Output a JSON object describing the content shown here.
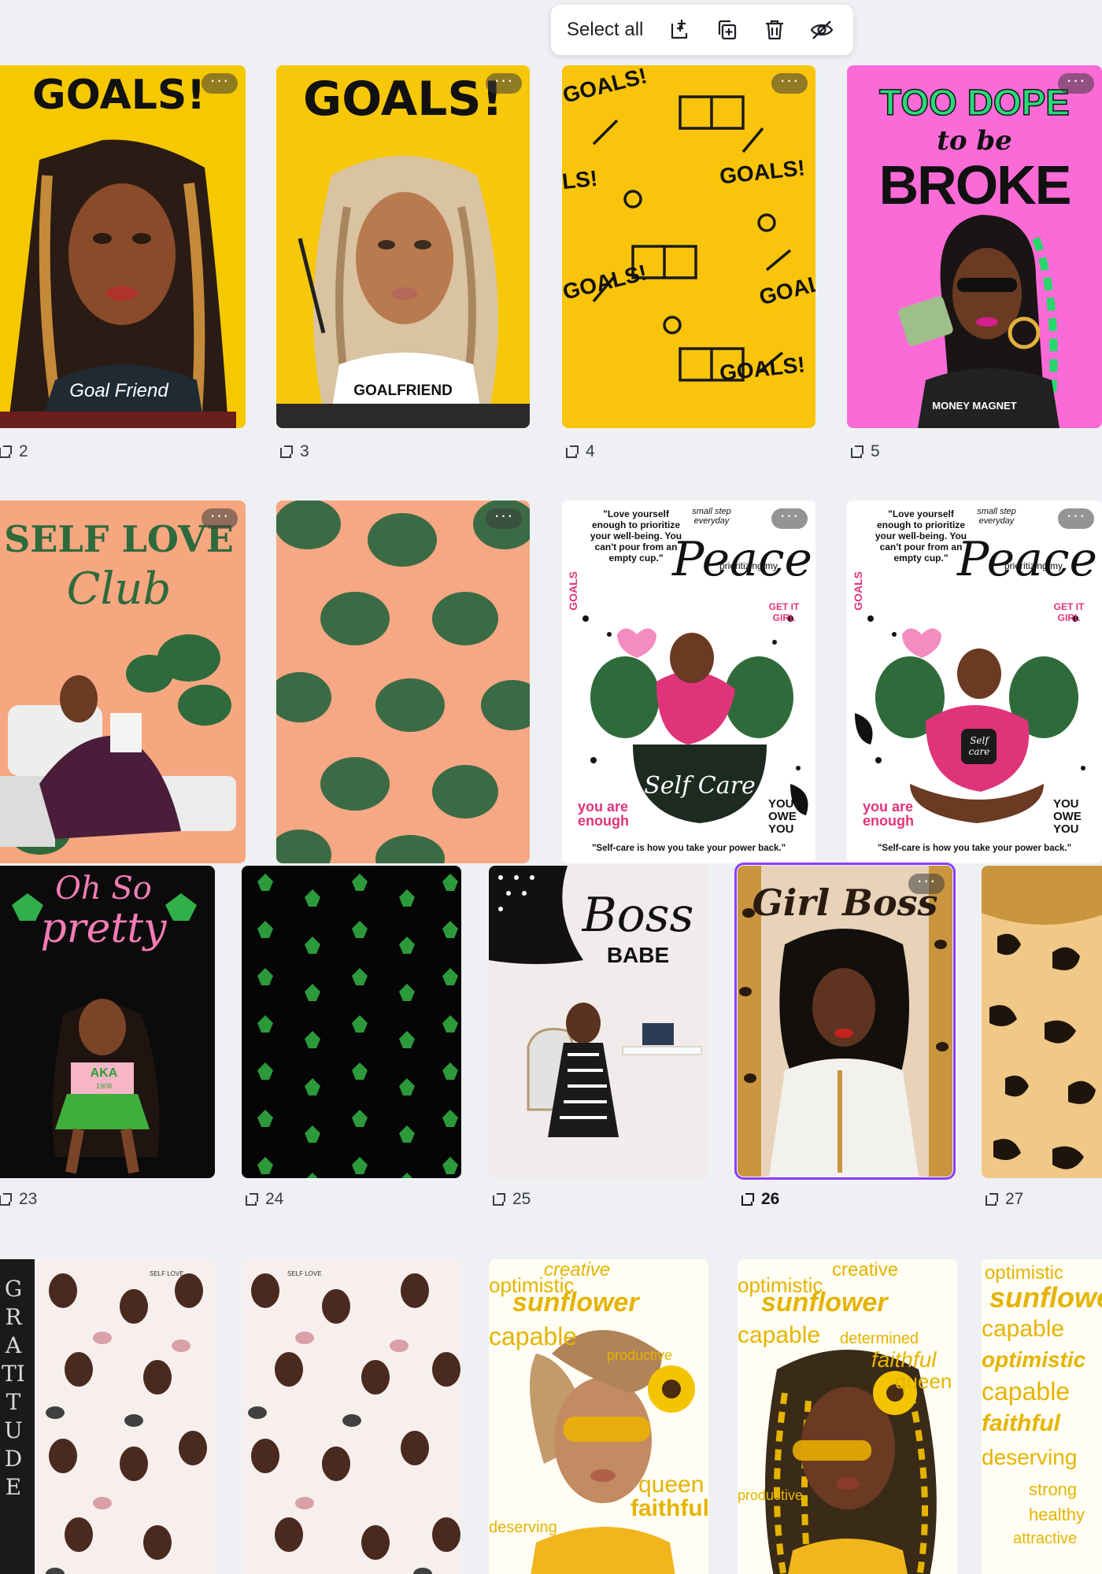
{
  "toolbar": {
    "select_all_label": "Select all",
    "icons": [
      "add-page-icon",
      "duplicate-icon",
      "trash-icon",
      "hide-icon"
    ]
  },
  "accent_color": "#8b3dff",
  "pages": [
    {
      "num": "2",
      "title": "GOALS!",
      "shirt": "Goal Friend",
      "bg": "#f6c800"
    },
    {
      "num": "3",
      "title": "GOALS!",
      "shirt": "GOALFRIEND",
      "bg": "#f7c70a"
    },
    {
      "num": "4",
      "pattern": [
        "GOALS!",
        "GOALS!",
        "GOALS!",
        "GOAL",
        "GOALS!",
        "LS!"
      ],
      "bg": "#f9c40b"
    },
    {
      "num": "5",
      "line1": "TOO DOPE",
      "line2": "to be",
      "line3": "BROKE",
      "shirt": "MONEY MAGNET",
      "bg": "#fb6bd7"
    },
    {
      "num": "",
      "line1": "SELF LOVE",
      "line2": "Club",
      "bg": "#f6a780"
    },
    {
      "num": "",
      "bg": "#f5a883"
    },
    {
      "num": "",
      "quote": "\"Love yourself enough to prioritize your well-being. You can't pour from an empty cup.\"",
      "tag": "small step everyday",
      "title": "Peace",
      "sub": "prioritizing my",
      "badge": "GET IT GIRL",
      "side": "GOALS",
      "cup": "Self Care",
      "left": "you are enough",
      "right": "YOU OWE YOU",
      "footer": "\"Self-care is how you take your power back.\""
    },
    {
      "num": "",
      "quote": "\"Love yourself enough to prioritize your well-being. You can't pour from an empty cup.\"",
      "tag": "small step everyday",
      "title": "Peace",
      "sub": "prioritizing my",
      "badge": "GET IT GIRL",
      "side": "GOALS",
      "cup": "Self care",
      "left": "you are enough",
      "right": "YOU OWE YOU",
      "footer": "\"Self-care is how you take your power back.\""
    },
    {
      "num": "23",
      "line1": "Oh So",
      "line2": "pretty",
      "shirt": "AKA",
      "year": "1908"
    },
    {
      "num": "24"
    },
    {
      "num": "25",
      "line1": "Boss",
      "line2": "BABE"
    },
    {
      "num": "26",
      "title": "Girl Boss"
    },
    {
      "num": "27"
    },
    {
      "num": "",
      "side": "GRATITUDE",
      "tile": "SELF LOVE"
    },
    {
      "num": "",
      "tile": "SELF LOVE"
    },
    {
      "num": "",
      "words": [
        "creative",
        "optimistic",
        "sunflower",
        "capable",
        "productive",
        "faithful",
        "deserving",
        "queen"
      ]
    },
    {
      "num": "",
      "words": [
        "creative",
        "optimistic",
        "sunflower",
        "capable",
        "determined",
        "faithful",
        "queen",
        "productive"
      ]
    },
    {
      "num": "",
      "words": [
        "optimistic",
        "sunflower",
        "capable",
        "optimistic",
        "capable",
        "faithful",
        "deserving",
        "strong",
        "healthy",
        "attractive"
      ]
    }
  ]
}
